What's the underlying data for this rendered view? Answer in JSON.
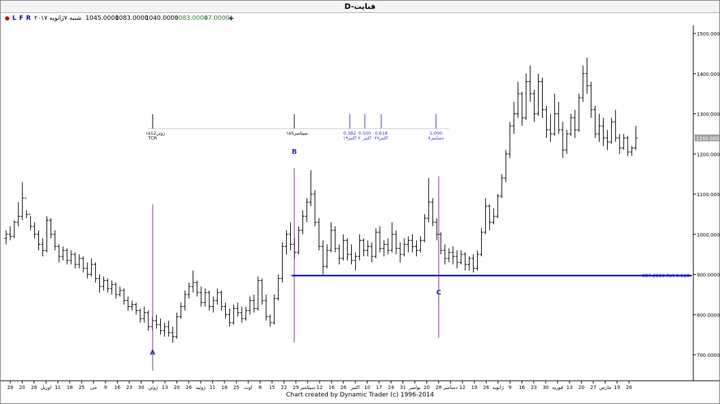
{
  "window": {
    "title": "D-قنايت"
  },
  "info": {
    "flags": [
      "L",
      "F",
      "R"
    ],
    "date": "شنبه ۷ژانویه ۲۰۱۷",
    "open": "1045.0000",
    "high": "1083.0000",
    "low": "1040.0000",
    "close": "1083.0000",
    "change": "47.0000"
  },
  "colors": {
    "background": "#ffffff",
    "bars": "#000000",
    "retracement_line": "#0000cc",
    "pivot_line": "#7a2a8a",
    "pivot_label": "#3333aa",
    "time_marker": "#3333cc",
    "change_text": "#2a7a2a",
    "last_price_box": "#a0a0a0"
  },
  "chart_data": {
    "type": "ohlc",
    "ylim": [
      650,
      1530
    ],
    "y_ticks": [
      "1500.0000",
      "1400.0000",
      "1300.0000",
      "1200.0000",
      "1100.0000",
      "1000.0000",
      "900.0000",
      "800.0000",
      "700.0000"
    ],
    "last_price": "1240.0000",
    "x_ticks": [
      "28",
      "20",
      "28",
      "اوريل",
      "11",
      "18",
      "25",
      "مى",
      "9",
      "16",
      "23",
      "30",
      "ژوئن",
      "13",
      "20",
      "26",
      "ژوئيه",
      "11",
      "18",
      "25",
      "اوت",
      "8",
      "15",
      "22",
      "29",
      "سپتامبر",
      "12",
      "16",
      "26",
      "اکتبر",
      "10",
      "17",
      "24",
      "31",
      "نوامبر",
      "20",
      "28",
      "دسامبر",
      "12",
      "19",
      "26",
      "ژانويه",
      "9",
      "16",
      "23",
      "30",
      "فوريه",
      "13",
      "20",
      "27",
      "مارس",
      "19",
      "26"
    ],
    "pivots": [
      {
        "label": "A",
        "price": 725
      },
      {
        "label": "B",
        "price": 1160
      },
      {
        "label": "C",
        "price": 897.26
      }
    ],
    "retracement": {
      "price": 897.26,
      "label": "897.2600 Ret 0.618"
    },
    "time_markers": [
      {
        "ratio": "",
        "date": "۱۵ژوئن12",
        "sub": "TCR"
      },
      {
        "ratio": "",
        "date": "۱۵سپتامبر5",
        "sub": ""
      },
      {
        "ratio": "0.382",
        "date": "۱۹اکتبر",
        "sub": ""
      },
      {
        "ratio": "0.500",
        "date": "۲۰اکتبر",
        "sub": ""
      },
      {
        "ratio": "0.618",
        "date": "۲۸اکتبر",
        "sub": ""
      },
      {
        "ratio": "1.000",
        "date": "۸دسامبر",
        "sub": ""
      }
    ],
    "series": [
      {
        "values": [
          [
            990,
            1010,
            975,
            1000
          ],
          [
            1000,
            1020,
            985,
            995
          ],
          [
            995,
            1035,
            990,
            1030
          ],
          [
            1030,
            1080,
            1020,
            1045
          ],
          [
            1045,
            1130,
            1035,
            1090
          ],
          [
            1090,
            1060,
            1040,
            1050
          ],
          [
            1050,
            1045,
            1010,
            1020
          ],
          [
            1020,
            1030,
            990,
            1000
          ],
          [
            1000,
            1010,
            960,
            975
          ],
          [
            975,
            990,
            945,
            960
          ],
          [
            960,
            1045,
            955,
            1035
          ],
          [
            1035,
            1040,
            990,
            1000
          ],
          [
            1000,
            1010,
            960,
            970
          ],
          [
            970,
            975,
            930,
            945
          ],
          [
            945,
            970,
            935,
            960
          ],
          [
            960,
            965,
            925,
            935
          ],
          [
            935,
            960,
            925,
            950
          ],
          [
            950,
            955,
            915,
            925
          ],
          [
            925,
            950,
            915,
            940
          ],
          [
            940,
            945,
            905,
            915
          ],
          [
            915,
            930,
            890,
            900
          ],
          [
            900,
            940,
            895,
            925
          ],
          [
            925,
            930,
            880,
            890
          ],
          [
            890,
            900,
            855,
            870
          ],
          [
            870,
            895,
            860,
            885
          ],
          [
            885,
            890,
            855,
            865
          ],
          [
            865,
            885,
            850,
            875
          ],
          [
            875,
            880,
            840,
            850
          ],
          [
            850,
            870,
            845,
            860
          ],
          [
            860,
            865,
            825,
            835
          ],
          [
            835,
            845,
            810,
            820
          ],
          [
            820,
            835,
            810,
            825
          ],
          [
            825,
            830,
            800,
            810
          ],
          [
            810,
            815,
            780,
            790
          ],
          [
            790,
            820,
            780,
            805
          ],
          [
            805,
            810,
            760,
            770
          ],
          [
            770,
            795,
            760,
            785
          ],
          [
            785,
            800,
            765,
            775
          ],
          [
            775,
            790,
            750,
            760
          ],
          [
            760,
            780,
            745,
            770
          ],
          [
            770,
            785,
            745,
            755
          ],
          [
            755,
            770,
            730,
            745
          ],
          [
            745,
            805,
            740,
            795
          ],
          [
            795,
            830,
            790,
            820
          ],
          [
            820,
            860,
            810,
            850
          ],
          [
            850,
            880,
            840,
            870
          ],
          [
            870,
            910,
            855,
            880
          ],
          [
            880,
            885,
            845,
            855
          ],
          [
            855,
            870,
            820,
            830
          ],
          [
            830,
            865,
            820,
            855
          ],
          [
            855,
            860,
            810,
            820
          ],
          [
            820,
            845,
            805,
            835
          ],
          [
            835,
            865,
            825,
            855
          ],
          [
            855,
            860,
            810,
            820
          ],
          [
            820,
            830,
            790,
            800
          ],
          [
            800,
            815,
            770,
            780
          ],
          [
            780,
            825,
            775,
            815
          ],
          [
            815,
            830,
            795,
            805
          ],
          [
            805,
            820,
            780,
            790
          ],
          [
            790,
            820,
            785,
            810
          ],
          [
            810,
            845,
            800,
            835
          ],
          [
            835,
            850,
            805,
            815
          ],
          [
            815,
            895,
            810,
            885
          ],
          [
            885,
            890,
            825,
            835
          ],
          [
            835,
            850,
            785,
            795
          ],
          [
            795,
            800,
            770,
            780
          ],
          [
            780,
            850,
            775,
            840
          ],
          [
            840,
            900,
            835,
            890
          ],
          [
            890,
            980,
            880,
            970
          ],
          [
            970,
            1010,
            950,
            1000
          ],
          [
            1000,
            1030,
            960,
            975
          ],
          [
            975,
            990,
            940,
            955
          ],
          [
            955,
            1020,
            950,
            1010
          ],
          [
            1010,
            1060,
            1000,
            1045
          ],
          [
            1045,
            1090,
            1030,
            1080
          ],
          [
            1080,
            1160,
            1070,
            1100
          ],
          [
            1100,
            1110,
            1020,
            1030
          ],
          [
            1030,
            1040,
            960,
            970
          ],
          [
            970,
            985,
            900,
            920
          ],
          [
            920,
            975,
            915,
            960
          ],
          [
            960,
            1030,
            955,
            1010
          ],
          [
            1010,
            1020,
            955,
            965
          ],
          [
            965,
            975,
            925,
            940
          ],
          [
            940,
            1000,
            935,
            985
          ],
          [
            985,
            990,
            935,
            950
          ],
          [
            950,
            975,
            925,
            935
          ],
          [
            935,
            955,
            910,
            945
          ],
          [
            945,
            1000,
            935,
            985
          ],
          [
            985,
            990,
            945,
            960
          ],
          [
            960,
            985,
            945,
            970
          ],
          [
            970,
            980,
            930,
            945
          ],
          [
            945,
            1015,
            940,
            1005
          ],
          [
            1005,
            1020,
            955,
            965
          ],
          [
            965,
            985,
            945,
            975
          ],
          [
            975,
            990,
            950,
            960
          ],
          [
            960,
            1030,
            955,
            1000
          ],
          [
            1000,
            1010,
            950,
            965
          ],
          [
            965,
            980,
            930,
            950
          ],
          [
            950,
            990,
            945,
            975
          ],
          [
            975,
            995,
            955,
            985
          ],
          [
            985,
            1000,
            955,
            970
          ],
          [
            970,
            985,
            945,
            960
          ],
          [
            960,
            995,
            955,
            985
          ],
          [
            985,
            1050,
            980,
            1040
          ],
          [
            1040,
            1140,
            1030,
            1080
          ],
          [
            1080,
            1090,
            1020,
            1030
          ],
          [
            1030,
            1040,
            985,
            1000
          ],
          [
            1000,
            1005,
            950,
            960
          ],
          [
            960,
            975,
            925,
            940
          ],
          [
            940,
            965,
            930,
            955
          ],
          [
            955,
            970,
            925,
            945
          ],
          [
            945,
            960,
            915,
            930
          ],
          [
            930,
            960,
            925,
            950
          ],
          [
            950,
            955,
            910,
            925
          ],
          [
            925,
            945,
            910,
            940
          ],
          [
            940,
            950,
            905,
            915
          ],
          [
            915,
            960,
            910,
            950
          ],
          [
            950,
            1015,
            945,
            1005
          ],
          [
            1005,
            1090,
            1000,
            1070
          ],
          [
            1070,
            1075,
            1010,
            1030
          ],
          [
            1030,
            1065,
            1025,
            1045
          ],
          [
            1045,
            1100,
            1040,
            1095
          ],
          [
            1095,
            1150,
            1090,
            1140
          ],
          [
            1140,
            1210,
            1130,
            1200
          ],
          [
            1200,
            1280,
            1190,
            1270
          ],
          [
            1270,
            1330,
            1250,
            1300
          ],
          [
            1300,
            1380,
            1290,
            1350
          ],
          [
            1350,
            1355,
            1270,
            1290
          ],
          [
            1290,
            1400,
            1285,
            1380
          ],
          [
            1380,
            1420,
            1330,
            1350
          ],
          [
            1350,
            1360,
            1280,
            1300
          ],
          [
            1300,
            1400,
            1295,
            1380
          ],
          [
            1380,
            1390,
            1290,
            1310
          ],
          [
            1310,
            1320,
            1240,
            1260
          ],
          [
            1260,
            1300,
            1230,
            1250
          ],
          [
            1250,
            1350,
            1245,
            1300
          ],
          [
            1300,
            1330,
            1250,
            1260
          ],
          [
            1260,
            1280,
            1190,
            1210
          ],
          [
            1210,
            1260,
            1200,
            1250
          ],
          [
            1250,
            1300,
            1245,
            1290
          ],
          [
            1290,
            1310,
            1240,
            1260
          ],
          [
            1260,
            1350,
            1255,
            1340
          ],
          [
            1340,
            1420,
            1330,
            1400
          ],
          [
            1400,
            1440,
            1350,
            1370
          ],
          [
            1370,
            1380,
            1290,
            1310
          ],
          [
            1310,
            1320,
            1240,
            1250
          ],
          [
            1250,
            1300,
            1230,
            1270
          ],
          [
            1270,
            1290,
            1220,
            1240
          ],
          [
            1240,
            1260,
            1210,
            1230
          ],
          [
            1230,
            1290,
            1225,
            1280
          ],
          [
            1280,
            1310,
            1230,
            1240
          ],
          [
            1240,
            1250,
            1200,
            1215
          ],
          [
            1215,
            1250,
            1210,
            1240
          ],
          [
            1240,
            1245,
            1195,
            1205
          ],
          [
            1205,
            1220,
            1195,
            1215
          ],
          [
            1215,
            1270,
            1210,
            1240
          ]
        ]
      }
    ]
  },
  "footer": {
    "credit": "Chart created by Dynamic Trader  (c)  1996-2014"
  }
}
